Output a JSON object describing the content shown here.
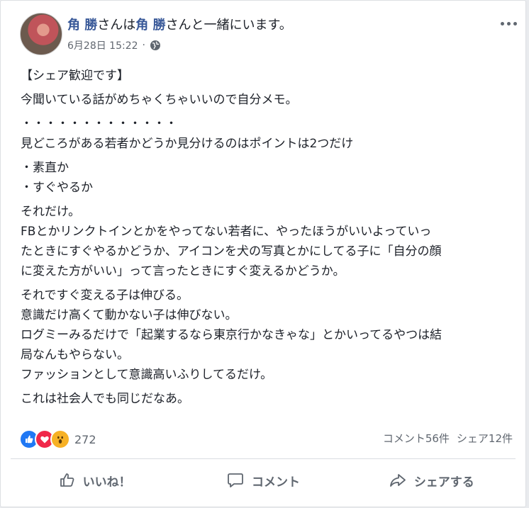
{
  "post": {
    "author": {
      "name": "角 勝",
      "with_text_1": "さんは",
      "tagged_name": "角 勝",
      "with_text_2": "さんと一緒にいます。"
    },
    "timestamp": "6月28日 15:22",
    "privacy_icon": "globe-icon",
    "more_icon": "more-options-icon",
    "lines": [
      "【シェア歓迎です】",
      "今聞いている話がめちゃくちゃいいので自分メモ。",
      "・・・・・・・・・・・・・",
      "見どころがある若者かどうか見分けるのはポイントは2つだけ",
      "・素直か",
      "・すぐやるか",
      "それだけ。",
      "FBとかリンクトインとかをやってない若者に、やったほうがいいよっていっ",
      "たときにすぐやるかどうか、アイコンを犬の写真とかにしてる子に「自分の顔",
      "に変えた方がいい」って言ったときにすぐ変えるかどうか。",
      "それですぐ変える子は伸びる。",
      "意識だけ高くて動かない子は伸びない。",
      "ログミーみるだけで「起業するなら東京行かなきゃな」とかいってるやつは結",
      "局なんもやらない。",
      "ファッションとして意識高いふりしてるだけ。",
      "これは社会人でも同じだなあ。"
    ]
  },
  "reactions": {
    "icons": [
      "like-icon",
      "love-icon",
      "wow-icon"
    ],
    "count": "272"
  },
  "counts": {
    "comments": "コメント56件",
    "shares": "シェア12件"
  },
  "actions": {
    "like": "いいね！",
    "comment": "コメント",
    "share": "シェアする"
  },
  "colors": {
    "link": "#385898",
    "secondary_text": "#606770",
    "like_blue": "#2078f4",
    "love_red": "#f0284a",
    "wow_yellow": "#f7b125"
  }
}
